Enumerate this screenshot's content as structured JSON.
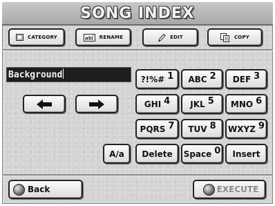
{
  "title": "SONG INDEX",
  "toolbar": {
    "category": "CATEGORY",
    "rename": "RENAME",
    "edit": "EDIT",
    "copy": "COPY"
  },
  "name_field": {
    "value": "Background"
  },
  "keypad": {
    "k1": {
      "main": "?!%#",
      "num": "1"
    },
    "k2": {
      "main": "ABC",
      "num": "2"
    },
    "k3": {
      "main": "DEF",
      "num": "3"
    },
    "k4": {
      "main": "GHI",
      "num": "4"
    },
    "k5": {
      "main": "JKL",
      "num": "5"
    },
    "k6": {
      "main": "MNO",
      "num": "6"
    },
    "k7": {
      "main": "PQRS",
      "num": "7"
    },
    "k8": {
      "main": "TUV",
      "num": "8"
    },
    "k9": {
      "main": "WXYZ",
      "num": "9"
    },
    "case": "A/a",
    "delete": "Delete",
    "space": {
      "main": "Space",
      "num": "0"
    },
    "insert": "Insert"
  },
  "footer": {
    "back": "Back",
    "execute": "EXECUTE"
  },
  "icons": {
    "category": "category-icon",
    "rename": "rename-icon",
    "edit": "edit-pen-icon",
    "copy": "copy-icon",
    "left": "arrow-left-icon",
    "right": "arrow-right-icon",
    "back": "back-knob-icon",
    "execute": "execute-knob-icon"
  }
}
